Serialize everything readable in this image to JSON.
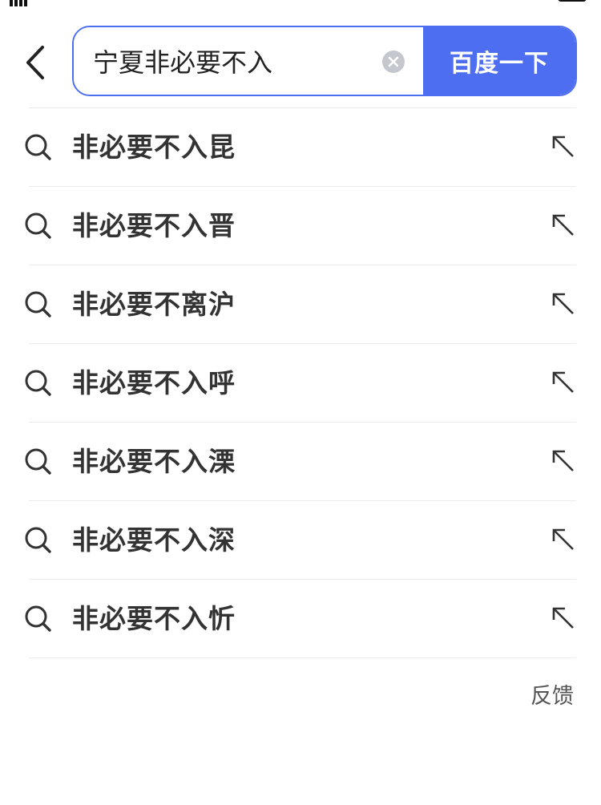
{
  "search": {
    "query": "宁夏非必要不入",
    "submit_label": "百度一下"
  },
  "suggestions": [
    {
      "label": "非必要不入昆"
    },
    {
      "label": "非必要不入晋"
    },
    {
      "label": "非必要不离沪"
    },
    {
      "label": "非必要不入呼"
    },
    {
      "label": "非必要不入溧"
    },
    {
      "label": "非必要不入深"
    },
    {
      "label": "非必要不入忻"
    }
  ],
  "feedback_label": "反馈",
  "colors": {
    "accent": "#4e6ef2",
    "text": "#333333",
    "divider": "#ececec"
  },
  "icons": {
    "back": "chevron-left-icon",
    "clear": "clear-circle-icon",
    "suggestion": "search-icon",
    "fill": "arrow-up-left-icon"
  }
}
